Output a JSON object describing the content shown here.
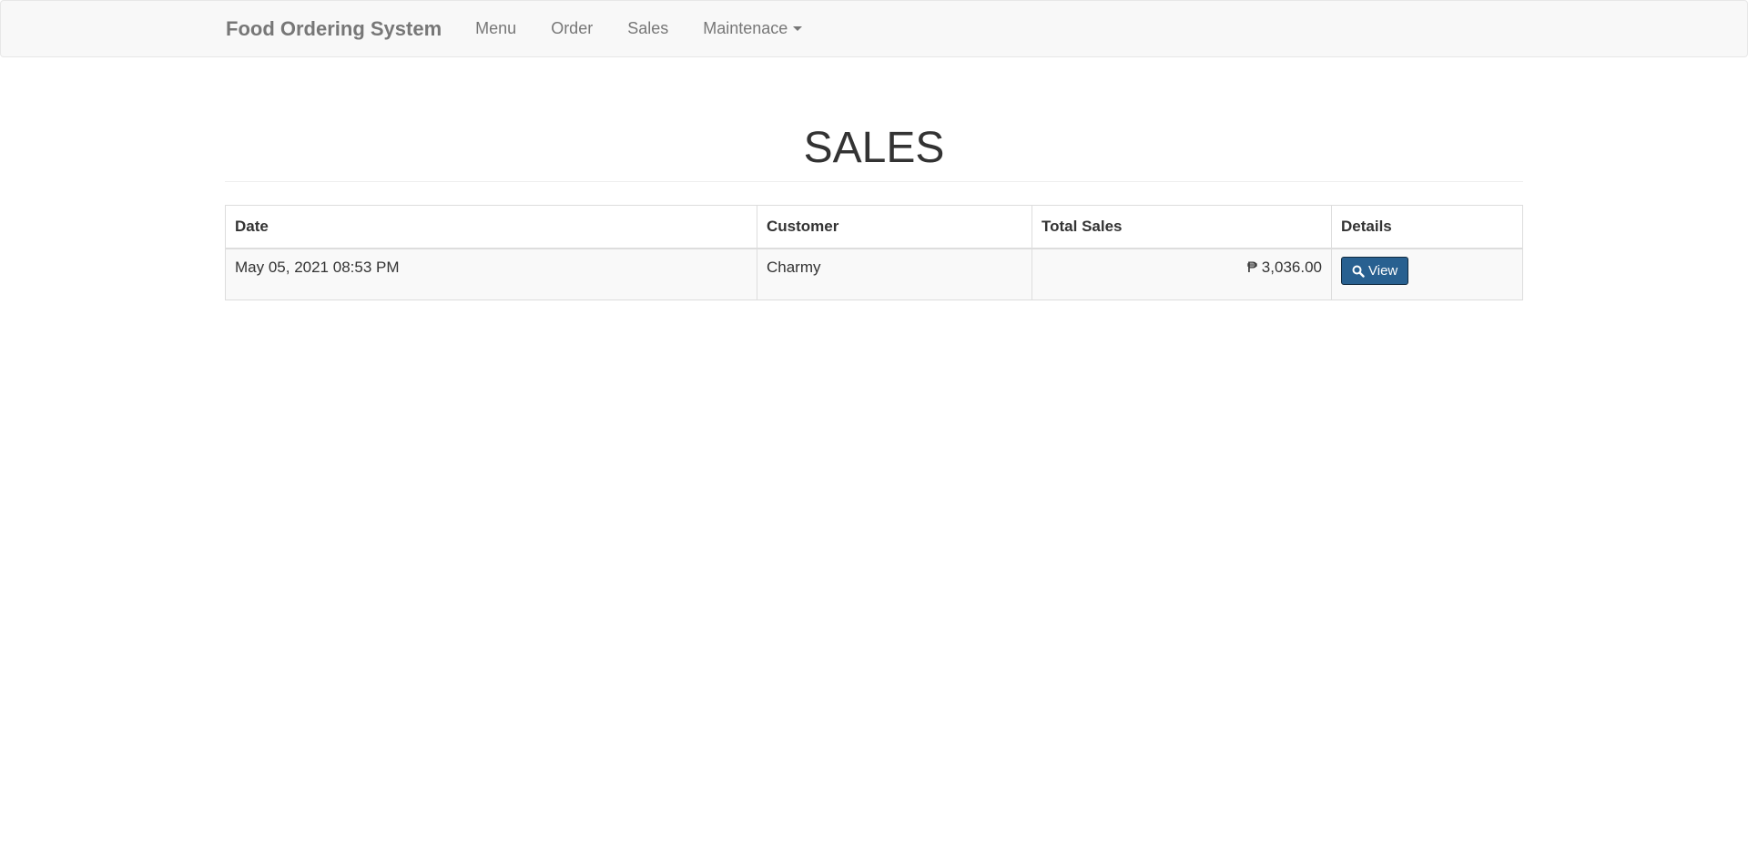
{
  "navbar": {
    "brand": "Food Ordering System",
    "links": [
      "Menu",
      "Order",
      "Sales"
    ],
    "dropdown_label": "Maintenace"
  },
  "page": {
    "title": "SALES"
  },
  "table": {
    "headers": [
      "Date",
      "Customer",
      "Total Sales",
      "Details"
    ],
    "rows": [
      {
        "date": "May 05, 2021 08:53 PM",
        "customer": "Charmy",
        "total": "₱ 3,036.00",
        "action": "View"
      }
    ]
  },
  "colors": {
    "navbar_bg": "#f8f8f8",
    "primary_button": "#286090"
  },
  "icons": {
    "view_button_icon": "search-icon",
    "dropdown_icon": "caret-down-icon"
  }
}
